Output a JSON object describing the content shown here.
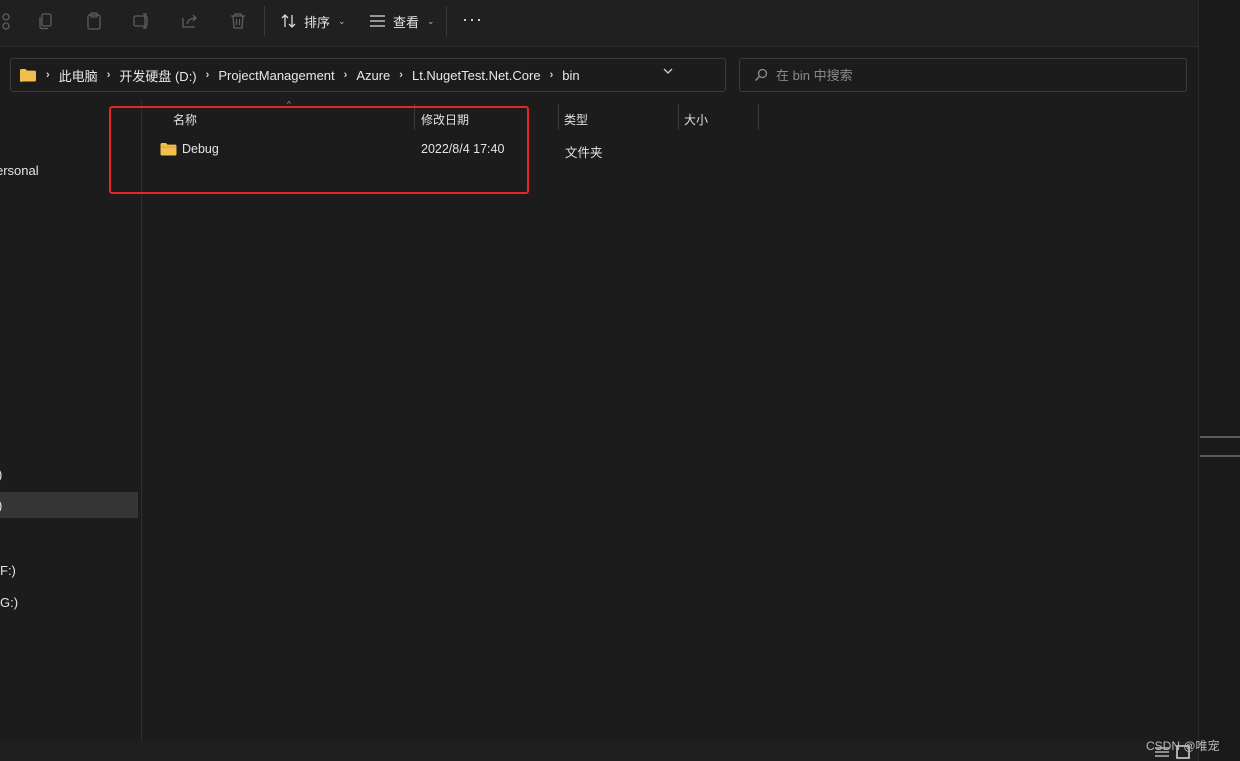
{
  "toolbar": {
    "sort_label": "排序",
    "view_label": "查看",
    "more_label": "···"
  },
  "address": {
    "crumbs": [
      "此电脑",
      "开发硬盘 (D:)",
      "ProjectManagement",
      "Azure",
      "Lt.NugetTest.Net.Core",
      "bin"
    ]
  },
  "search": {
    "placeholder": "在 bin 中搜索"
  },
  "nav": {
    "items": [
      "ersonal",
      ")",
      ")",
      "F:)",
      "G:)"
    ]
  },
  "columns": {
    "name": "名称",
    "modified": "修改日期",
    "type": "类型",
    "size": "大小"
  },
  "files": [
    {
      "name": "Debug",
      "modified": "2022/8/4 17:40",
      "type": "文件夹",
      "size": ""
    }
  ],
  "watermark": "CSDN @唯宠",
  "colors": {
    "highlight": "#e0282a",
    "folder": "#f0c04a",
    "background": "#1c1c1c"
  }
}
